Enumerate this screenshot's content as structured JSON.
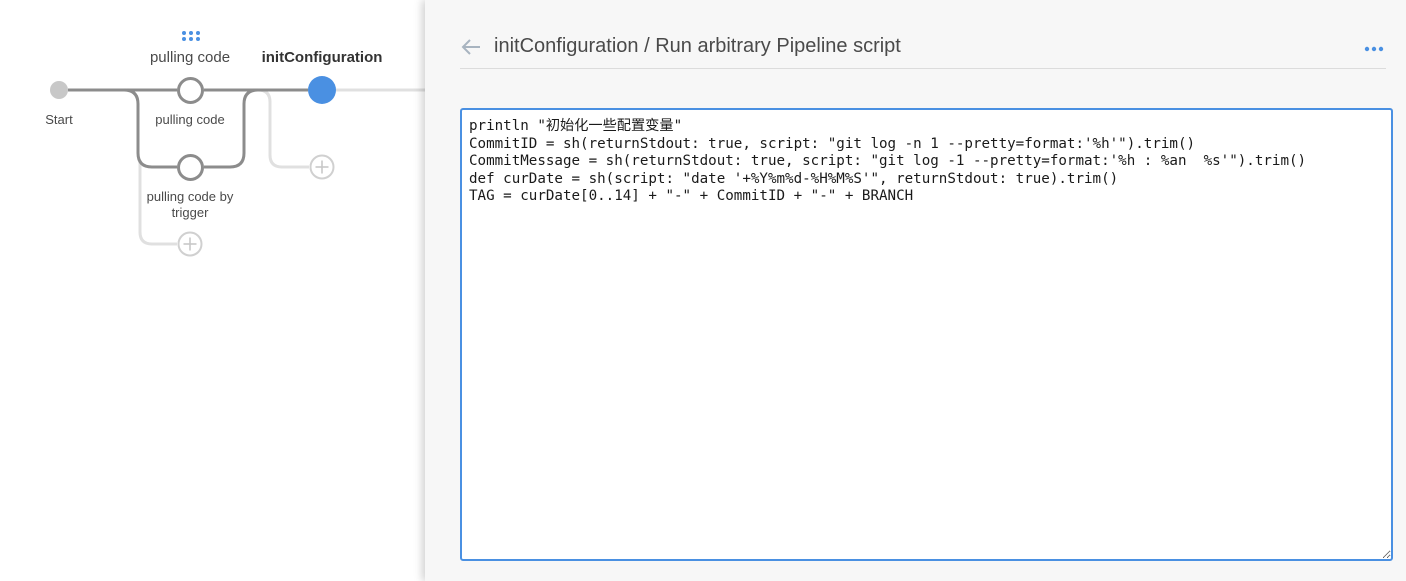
{
  "pipeline": {
    "stages": [
      {
        "title": "pulling code",
        "active": false
      },
      {
        "title": "initConfiguration",
        "active": true
      }
    ],
    "nodes": {
      "start": "Start",
      "pulling_code": "pulling code",
      "pulling_code_by_trigger": "pulling code by trigger"
    }
  },
  "panel": {
    "title": "initConfiguration / Run arbitrary Pipeline script",
    "script": "println \"初始化一些配置变量\"\nCommitID = sh(returnStdout: true, script: \"git log -n 1 --pretty=format:'%h'\").trim()\nCommitMessage = sh(returnStdout: true, script: \"git log -1 --pretty=format:'%h : %an  %s'\").trim()\ndef curDate = sh(script: \"date '+%Y%m%d-%H%M%S'\", returnStdout: true).trim()\nTAG = curDate[0..14] + \"-\" + CommitID + \"-\" + BRANCH"
  },
  "icons": {
    "back": "back-arrow-icon",
    "more": "more-dots-icon",
    "drag": "drag-handle-icon",
    "add": "add-circle-icon"
  },
  "colors": {
    "accent": "#4a90e2",
    "node_border": "#8c8c8c",
    "line": "#8c8c8c",
    "light_line": "#e0e0e0",
    "panel_bg": "#f7f7f7"
  }
}
